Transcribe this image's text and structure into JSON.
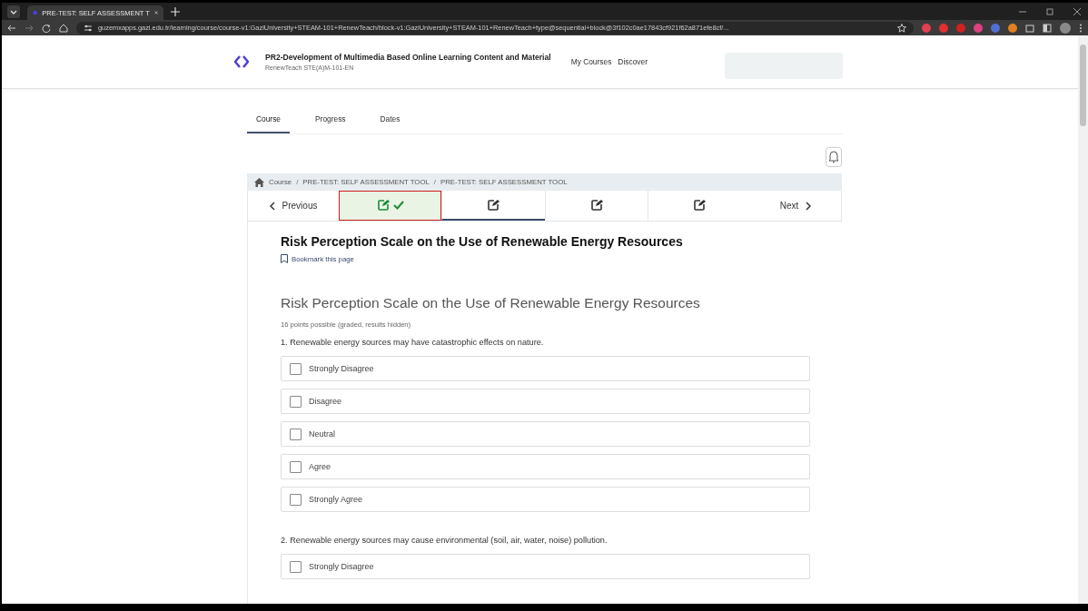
{
  "browser": {
    "tabs": [
      {
        "title": "PRE-TEST: SELF ASSESSMENT T",
        "selected": true
      }
    ],
    "url": "guzemxapps.gazi.edu.tr/learning/course/course-v1:GaziUniversity+STEAM-101+RenewTeach/block-v1:GaziUniversity+STEAM-101+RenewTeach+type@sequential+block@3f102c0ae17843cf921f62a871efe8cf/..."
  },
  "header": {
    "course_title": "PR2-Development of Multimedia Based Online Learning Content and Material",
    "course_code": "RenewTeach STE(A)M-101-EN",
    "nav": [
      "My Courses",
      "Discover"
    ]
  },
  "course_tabs": [
    {
      "label": "Course",
      "selected": true
    },
    {
      "label": "Progress",
      "selected": false
    },
    {
      "label": "Dates",
      "selected": false
    }
  ],
  "breadcrumb": {
    "separator": "/",
    "items": [
      "Course",
      "PRE-TEST: SELF ASSESSMENT TOOL",
      "PRE-TEST: SELF ASSESSMENT TOOL"
    ]
  },
  "sequence": {
    "previous": "Previous",
    "next": "Next",
    "units": [
      {
        "completed": true,
        "selected": false,
        "highlighted": true
      },
      {
        "completed": false,
        "selected": true,
        "highlighted": false
      },
      {
        "completed": false,
        "selected": false,
        "highlighted": false
      },
      {
        "completed": false,
        "selected": false,
        "highlighted": false
      }
    ]
  },
  "unit_title": "Risk Perception Scale on the Use of Renewable Energy Resources",
  "bookmark": "Bookmark this page",
  "problem": {
    "title": "Risk Perception Scale on the Use of Renewable Energy Resources",
    "points": "16 points possible (graded, results hidden)",
    "questions": [
      {
        "text": "1. Renewable energy sources may have catastrophic effects on nature.",
        "options": [
          {
            "label": "Strongly Disagree",
            "checked": false
          },
          {
            "label": "Disagree",
            "checked": false
          },
          {
            "label": "Neutral",
            "checked": false
          },
          {
            "label": "Agree",
            "checked": false
          },
          {
            "label": "Strongly Agree",
            "checked": false
          }
        ]
      },
      {
        "text": "2. Renewable energy sources may cause environmental (soil, air, water, noise) pollution.",
        "options": [
          {
            "label": "Strongly Disagree",
            "checked": false
          }
        ]
      }
    ]
  }
}
